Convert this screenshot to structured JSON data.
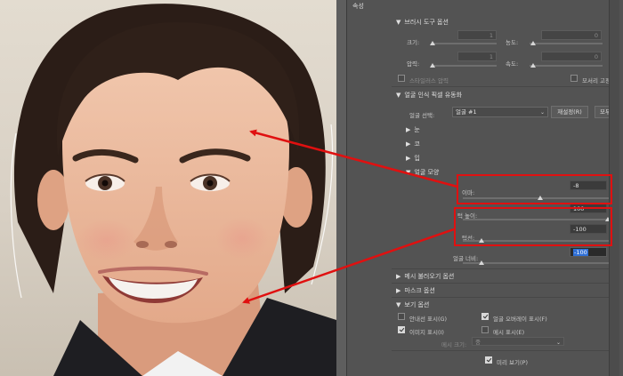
{
  "panel": {
    "title": "속성",
    "brush_section": {
      "title": "브러시 도구 옵션",
      "size_label": "크기:",
      "size_value": "1",
      "density_label": "농도:",
      "density_value": "0",
      "pressure_label": "압력:",
      "pressure_value": "1",
      "rate_label": "속도:",
      "rate_value": "0",
      "stylus_label": "스타일러스 압력",
      "pin_edges_label": "모서리 고정"
    },
    "face_section": {
      "title": "얼굴 인식 픽셀 유동화",
      "select_face_label": "얼굴 선택:",
      "face_value": "얼굴 #1",
      "reset_label": "재설정(R)",
      "all_label": "모두",
      "eyes_label": "눈",
      "nose_label": "코",
      "mouth_label": "입",
      "face_shape_label": "얼굴 모양",
      "forehead_label": "이마:",
      "forehead_value": "-8",
      "chin_height_label": "턱 높이:",
      "chin_height_value": "100",
      "jawline_label": "턱선:",
      "jawline_value": "-100",
      "face_width_label": "얼굴 너비:",
      "face_width_value": "-100"
    },
    "mesh_load_section": {
      "title": "메시 불러오기 옵션"
    },
    "mask_section": {
      "title": "마스크 옵션"
    },
    "view_section": {
      "title": "보기 옵션",
      "guides_label": "안내선 표시(G)",
      "guides_checked": false,
      "face_overlay_label": "얼굴 오버레이 표시(F)",
      "face_overlay_checked": true,
      "image_label": "이미지 표시(I)",
      "image_checked": true,
      "mesh_label": "메시 표시(E)",
      "mesh_checked": false,
      "mesh_size_label": "메시 크기:",
      "mesh_size_value": "중"
    },
    "preview_label": "미리 보기(P)",
    "preview_checked": true
  },
  "colors": {
    "panel_bg": "#535353",
    "highlight": "#e01010",
    "arrow": "#e01010",
    "selection": "#2f6fd6"
  },
  "icons": [
    "expand-triangle-icon",
    "collapse-triangle-icon",
    "checkbox-icon",
    "dropdown-caret-icon"
  ]
}
